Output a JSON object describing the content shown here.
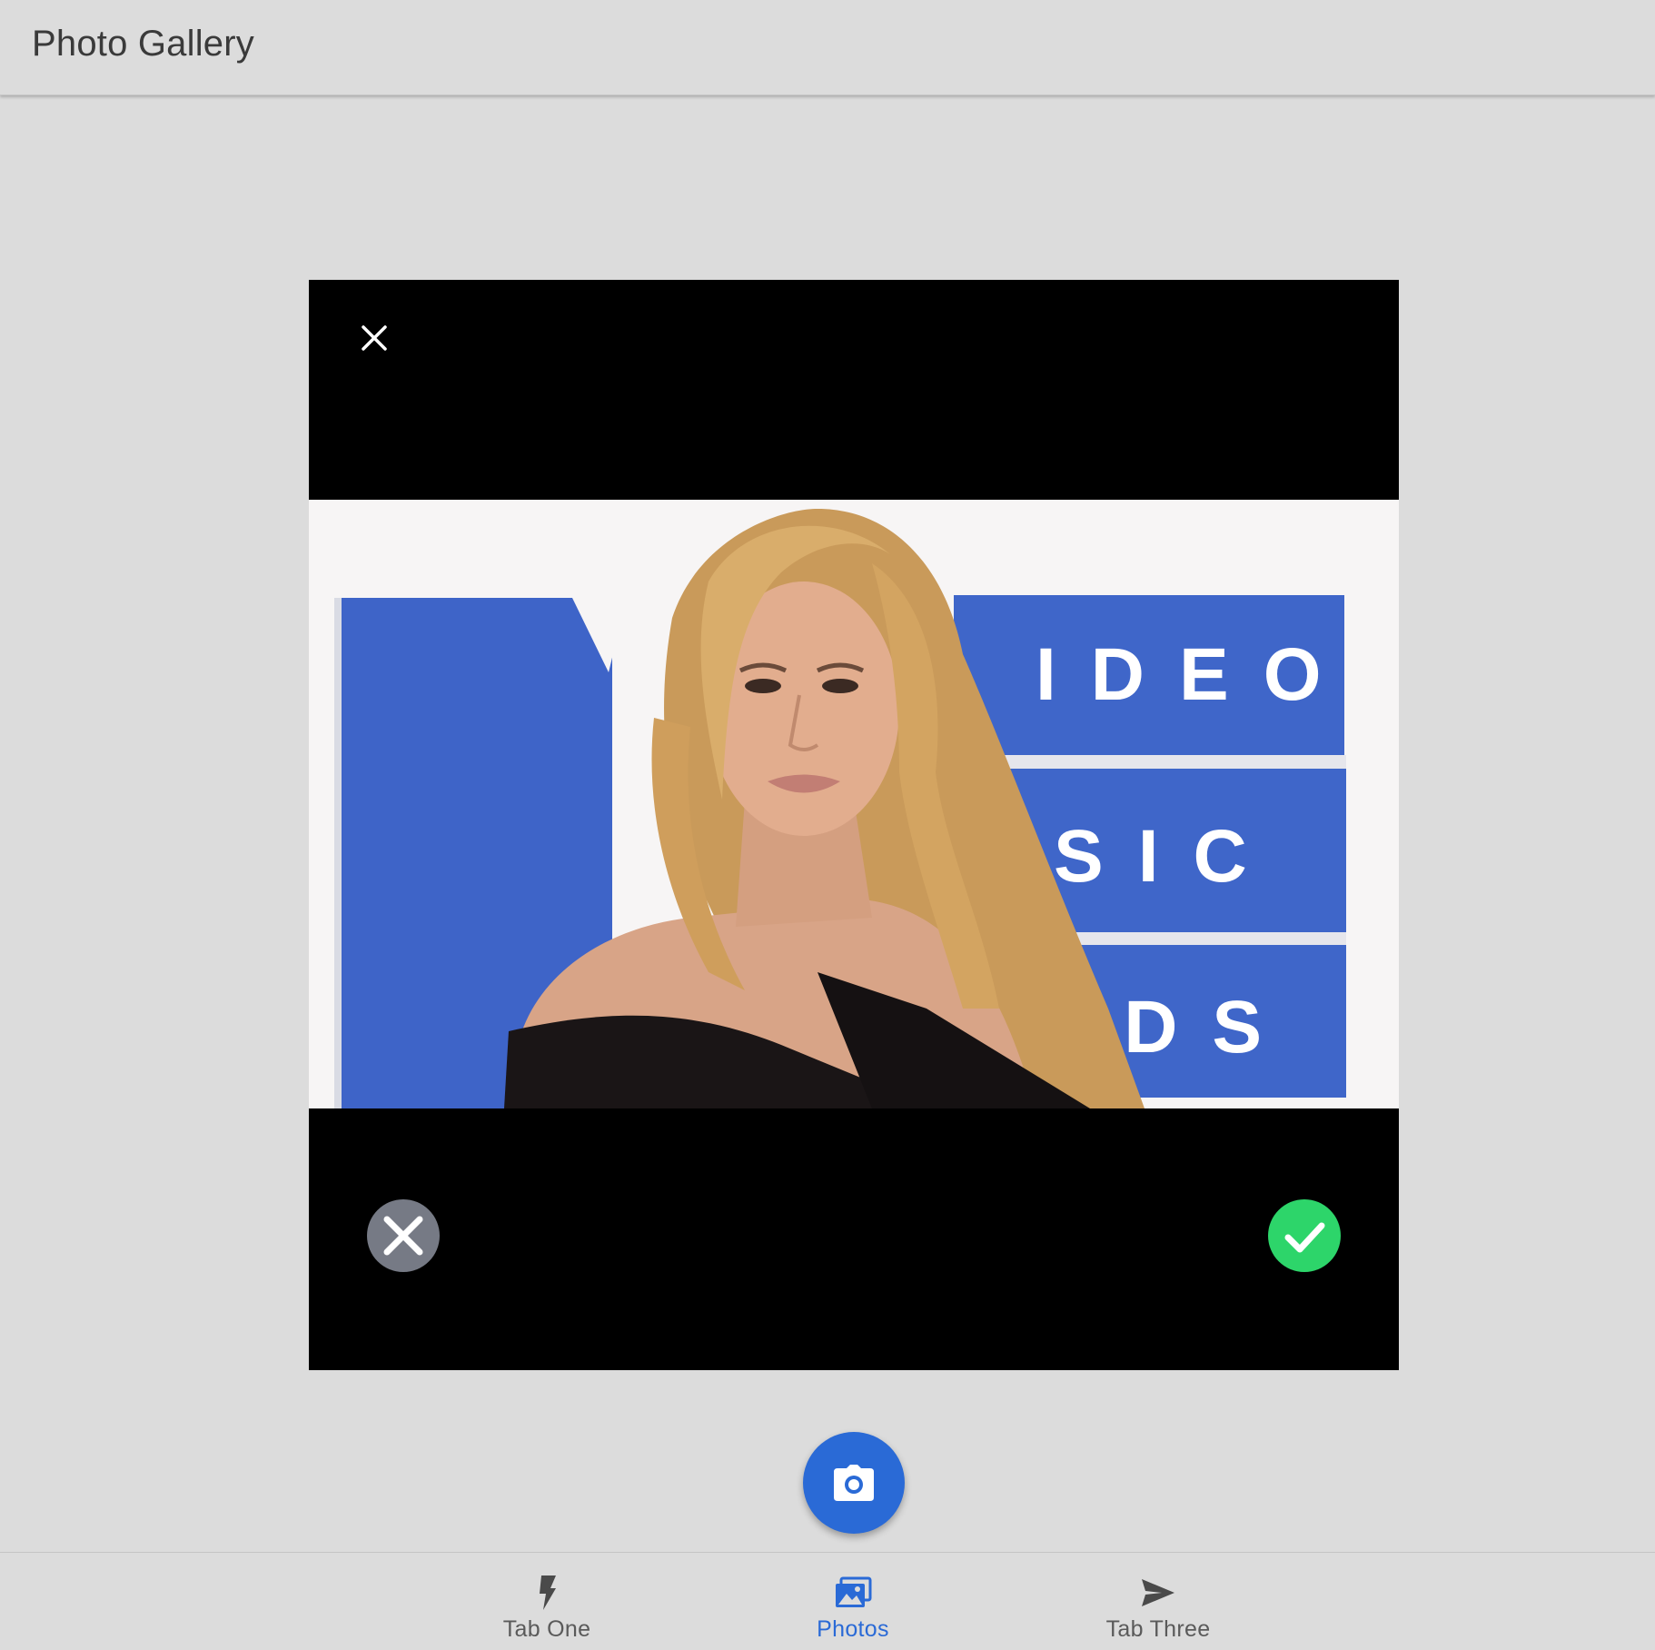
{
  "header": {
    "title": "Photo Gallery"
  },
  "preview": {
    "close_icon": "close-icon",
    "photo_subject": "photo-preview",
    "backdrop_text": {
      "line1": "IDEO",
      "line2": "SIC",
      "line3": "RDS"
    },
    "discard_icon": "close-circle-icon",
    "confirm_icon": "checkmark-circle-icon"
  },
  "fab": {
    "icon": "camera-icon"
  },
  "tabs": [
    {
      "label": "Tab One",
      "icon": "flash-icon",
      "active": false
    },
    {
      "label": "Photos",
      "icon": "images-icon",
      "active": true
    },
    {
      "label": "Tab Three",
      "icon": "send-icon",
      "active": false
    }
  ],
  "colors": {
    "background": "#dcdcdc",
    "accent": "#2a6ad6",
    "confirm": "#2dd56a",
    "discard": "#767a85"
  }
}
